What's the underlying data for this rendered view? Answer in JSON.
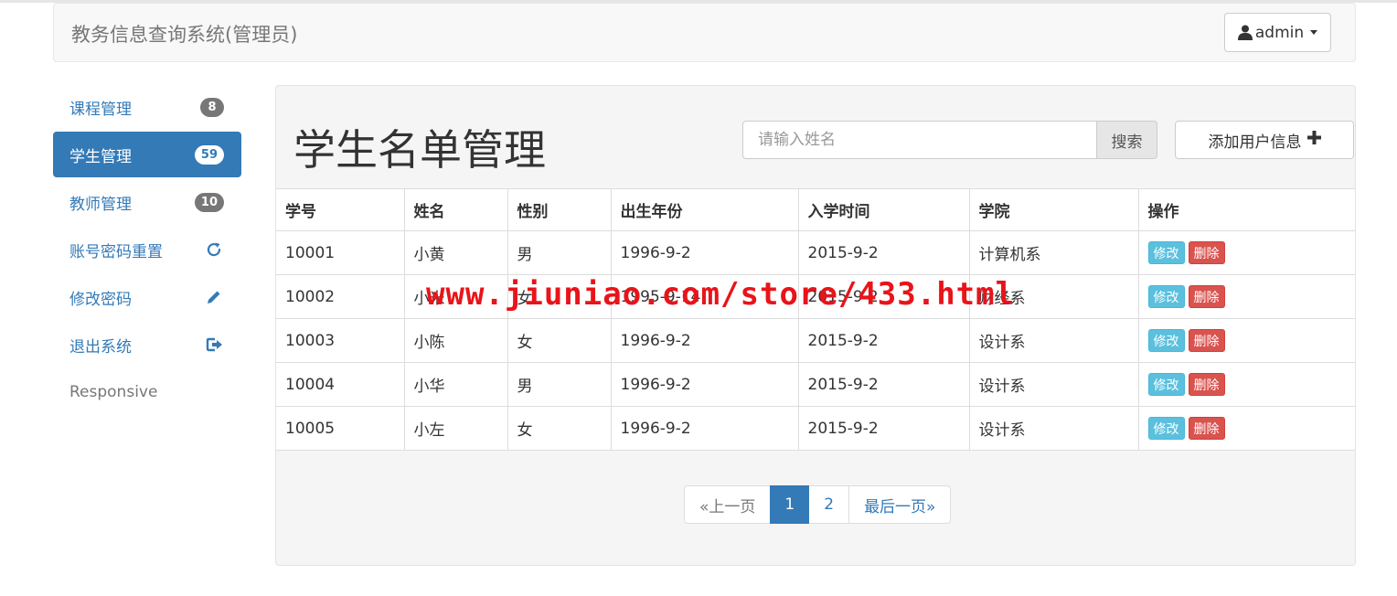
{
  "navbar": {
    "brand": "教务信息查询系统(管理员)",
    "user_label": "admin"
  },
  "sidebar": {
    "items": [
      {
        "label": "课程管理",
        "badge": "8",
        "active": false
      },
      {
        "label": "学生管理",
        "badge": "59",
        "active": true
      },
      {
        "label": "教师管理",
        "badge": "10",
        "active": false
      },
      {
        "label": "账号密码重置",
        "icon": "refresh-icon"
      },
      {
        "label": "修改密码",
        "icon": "pencil-icon"
      },
      {
        "label": "退出系统",
        "icon": "logout-icon"
      }
    ],
    "footer_text": "Responsive"
  },
  "main": {
    "title": "学生名单管理",
    "search": {
      "placeholder": "请输入姓名",
      "value": "",
      "button_label": "搜索"
    },
    "add_button_label": "添加用户信息",
    "table": {
      "headers": [
        "学号",
        "姓名",
        "性别",
        "出生年份",
        "入学时间",
        "学院",
        "操作"
      ],
      "rows": [
        [
          "10001",
          "小黄",
          "男",
          "1996-9-2",
          "2015-9-2",
          "计算机系"
        ],
        [
          "10002",
          "小米",
          "女",
          "1995-9-14",
          "2015-9-2",
          "财经系"
        ],
        [
          "10003",
          "小陈",
          "女",
          "1996-9-2",
          "2015-9-2",
          "设计系"
        ],
        [
          "10004",
          "小华",
          "男",
          "1996-9-2",
          "2015-9-2",
          "设计系"
        ],
        [
          "10005",
          "小左",
          "女",
          "1996-9-2",
          "2015-9-2",
          "设计系"
        ]
      ],
      "edit_label": "修改",
      "delete_label": "删除"
    },
    "pagination": {
      "prev_label": "«上一页",
      "pages": [
        "1",
        "2"
      ],
      "current_page": "1",
      "last_label": "最后一页»"
    }
  },
  "watermark": "www.jiuniao.com/store/433.html",
  "colors": {
    "primary": "#337ab7",
    "info": "#5bc0de",
    "danger": "#d9534f",
    "badge": "#777777",
    "watermark": "#e8141a"
  }
}
